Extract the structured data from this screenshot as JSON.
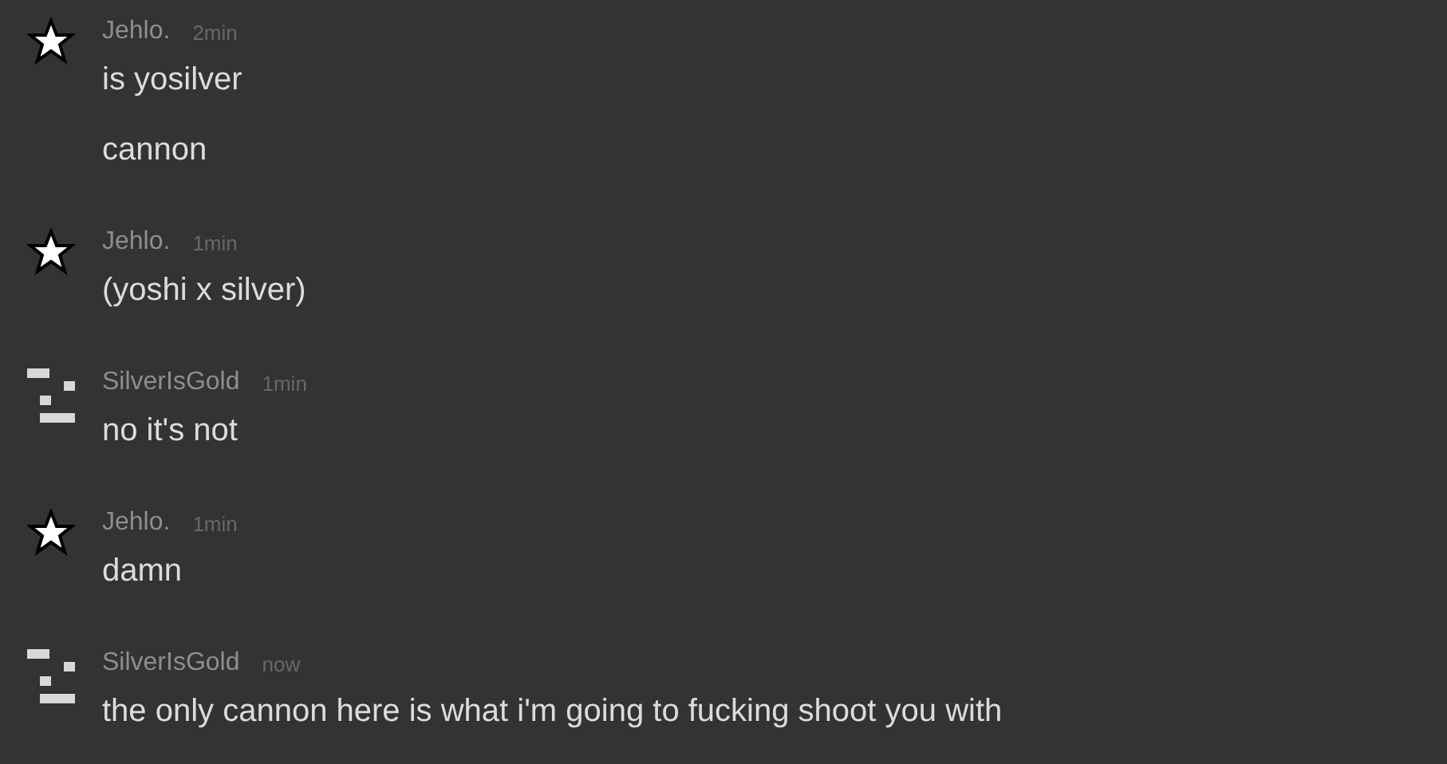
{
  "messages": [
    {
      "avatar": {
        "kind": "star"
      },
      "author": "Jehlo.",
      "time": "2min",
      "lines": [
        "is yosilver",
        "cannon"
      ]
    },
    {
      "avatar": {
        "kind": "star"
      },
      "author": "Jehlo.",
      "time": "1min",
      "lines": [
        "(yoshi x silver)"
      ]
    },
    {
      "avatar": {
        "kind": "blocks"
      },
      "author": "SilverIsGold",
      "time": "1min",
      "lines": [
        "no it's not"
      ]
    },
    {
      "avatar": {
        "kind": "star"
      },
      "author": "Jehlo.",
      "time": "1min",
      "lines": [
        "damn"
      ]
    },
    {
      "avatar": {
        "kind": "blocks"
      },
      "author": "SilverIsGold",
      "time": "now",
      "lines": [
        "the only cannon here is what i'm going to fucking shoot you with"
      ]
    }
  ]
}
